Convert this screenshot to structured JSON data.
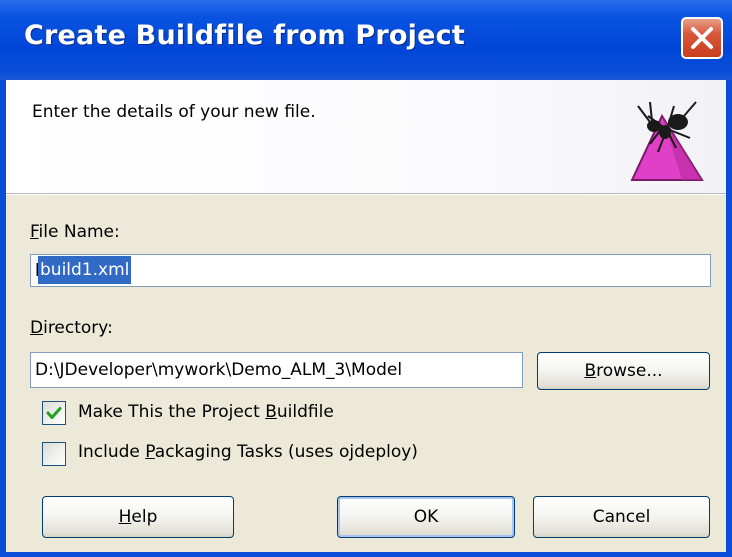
{
  "window": {
    "title": "Create Buildfile from Project",
    "close_icon": "close-icon"
  },
  "header": {
    "instruction": "Enter the details of your new file.",
    "logo_icon": "ant-logo-icon"
  },
  "file_name": {
    "label_mnemonic": "F",
    "label_rest": "ile Name:",
    "value": "build1.xml"
  },
  "directory": {
    "label_mnemonic": "D",
    "label_rest": "irectory:",
    "value": "D:\\JDeveloper\\mywork\\Demo_ALM_3\\Model",
    "browse_label_mnemonic": "B",
    "browse_label_rest": "rowse..."
  },
  "options": {
    "make_buildfile": {
      "label_before": "Make This the Project ",
      "label_mnemonic": "B",
      "label_after": "uildfile",
      "checked": true
    },
    "include_packaging": {
      "label_before": "Include ",
      "label_mnemonic": "P",
      "label_after": "ackaging Tasks (uses ojdeploy)",
      "checked": false
    }
  },
  "buttons": {
    "help_mnemonic": "H",
    "help_rest": "elp",
    "ok": "OK",
    "cancel": "Cancel"
  },
  "colors": {
    "title_bar": "#0146d8",
    "dialog_body": "#ece9d8",
    "selection": "#316ac5",
    "close_button": "#d8563a"
  }
}
